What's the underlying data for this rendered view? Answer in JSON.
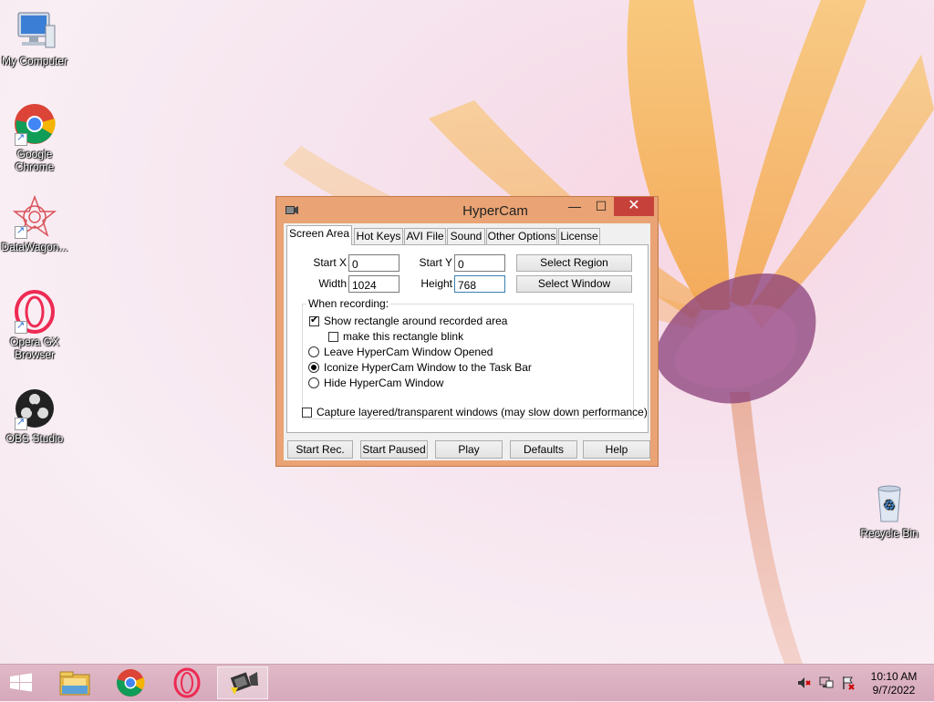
{
  "desktop": {
    "icons": [
      {
        "label": "My Computer"
      },
      {
        "label": "Google Chrome"
      },
      {
        "label": "DataWagon..."
      },
      {
        "label": "Opera GX Browser"
      },
      {
        "label": "OBS Studio"
      },
      {
        "label": "Recycle Bin"
      }
    ]
  },
  "window": {
    "title": "HyperCam",
    "controls": {
      "minimize": "—",
      "maximize": "☐",
      "close": "✕"
    },
    "tabs": [
      {
        "label": "Screen Area",
        "active": true
      },
      {
        "label": "Hot Keys"
      },
      {
        "label": "AVI File"
      },
      {
        "label": "Sound"
      },
      {
        "label": "Other Options"
      },
      {
        "label": "License"
      }
    ],
    "screen_area": {
      "start_x_label": "Start X",
      "start_x_value": "0",
      "start_y_label": "Start Y",
      "start_y_value": "0",
      "width_label": "Width",
      "width_value": "1024",
      "height_label": "Height",
      "height_value": "768",
      "select_region": "Select Region",
      "select_window": "Select Window",
      "group_title": "When recording:",
      "show_rectangle": {
        "label": "Show rectangle around recorded area",
        "checked": true
      },
      "blink": {
        "label": "make this rectangle blink",
        "checked": false
      },
      "radio_options": [
        {
          "label": "Leave HyperCam Window Opened",
          "selected": false
        },
        {
          "label": "Iconize HyperCam Window to the Task Bar",
          "selected": true
        },
        {
          "label": "Hide HyperCam Window",
          "selected": false
        }
      ],
      "capture_layered": {
        "label": "Capture layered/transparent windows (may slow down performance)",
        "checked": false
      }
    },
    "buttons": {
      "start_rec": "Start Rec.",
      "start_paused": "Start Paused",
      "play": "Play",
      "defaults": "Defaults",
      "help": "Help"
    }
  },
  "taskbar": {
    "clock_time": "10:10 AM",
    "clock_date": "9/7/2022"
  },
  "colors": {
    "title_bar": "#e9a374",
    "close_button": "#c7413b",
    "taskbar": "#d9aebf"
  }
}
